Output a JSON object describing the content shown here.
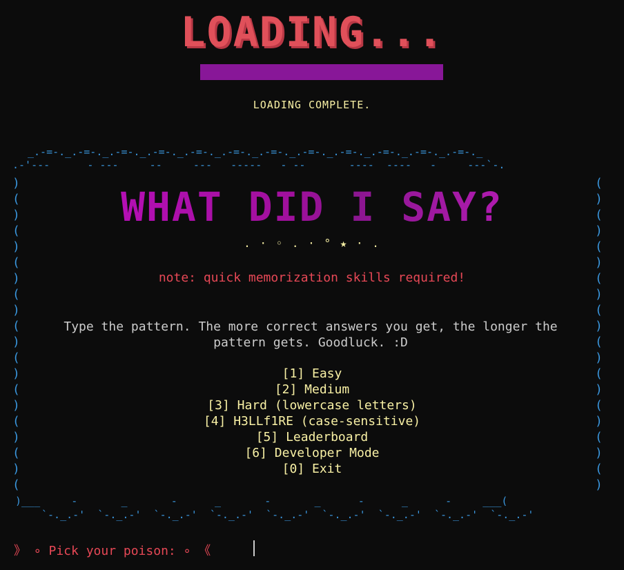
{
  "loading": {
    "banner": "LOADING...",
    "progress": 1.0,
    "status": "LOADING COMPLETE."
  },
  "frame": {
    "top_line_1": "_.-=-._.-=-._.-=-._.-=-._.-=-._.-=-._.-=-._.-=-._.-=-._.-=-._.-=-._.-=-._",
    "top_line_2": ".-'---      - ---     --     ---   -----   - --       ----  ----   -     ---`-.",
    "bottom_line_1": ")___     -       _       -      _       -       _      -      _      -     ___(",
    "bottom_line_2": "`-._.-'  `-._.-'  `-._.-'  `-._.-'  `-._.-'  `-._.-'  `-._.-'  `-._.-'  `-._.-'",
    "left_column": ")\n(\n)\n(\n)\n(\n)\n(\n)\n(\n)\n(\n)\n(\n)\n(\n)\n(\n)\n(",
    "right_column": "(\n)\n(\n)\n(\n)\n(\n)\n(\n)\n(\n)\n(\n)\n(\n)\n(\n)\n(\n)"
  },
  "title": "WHAT DID I SAY?",
  "sparkles": ". · ◦ . · ° ★ · .",
  "note": "note: quick memorization skills required!",
  "instructions": "Type the pattern. The more correct answers you get,  the longer the pattern gets. Goodluck. :D",
  "menu": [
    {
      "label": "[1] Easy"
    },
    {
      "label": "[2] Medium"
    },
    {
      "label": "[3] Hard (lowercase letters)"
    },
    {
      "label": "[4] H3LLf1RE (case-sensitive)"
    },
    {
      "label": "[5] Leaderboard"
    },
    {
      "label": "[6] Developer Mode"
    },
    {
      "label": "[0] Exit"
    }
  ],
  "prompt": "》 ∘ Pick your poison: ∘ 《",
  "colors": {
    "background": "#0c0c0c",
    "red": "#e74856",
    "yellow": "#f9f1a5",
    "blue": "#3a96dd",
    "magenta": "#881798"
  }
}
